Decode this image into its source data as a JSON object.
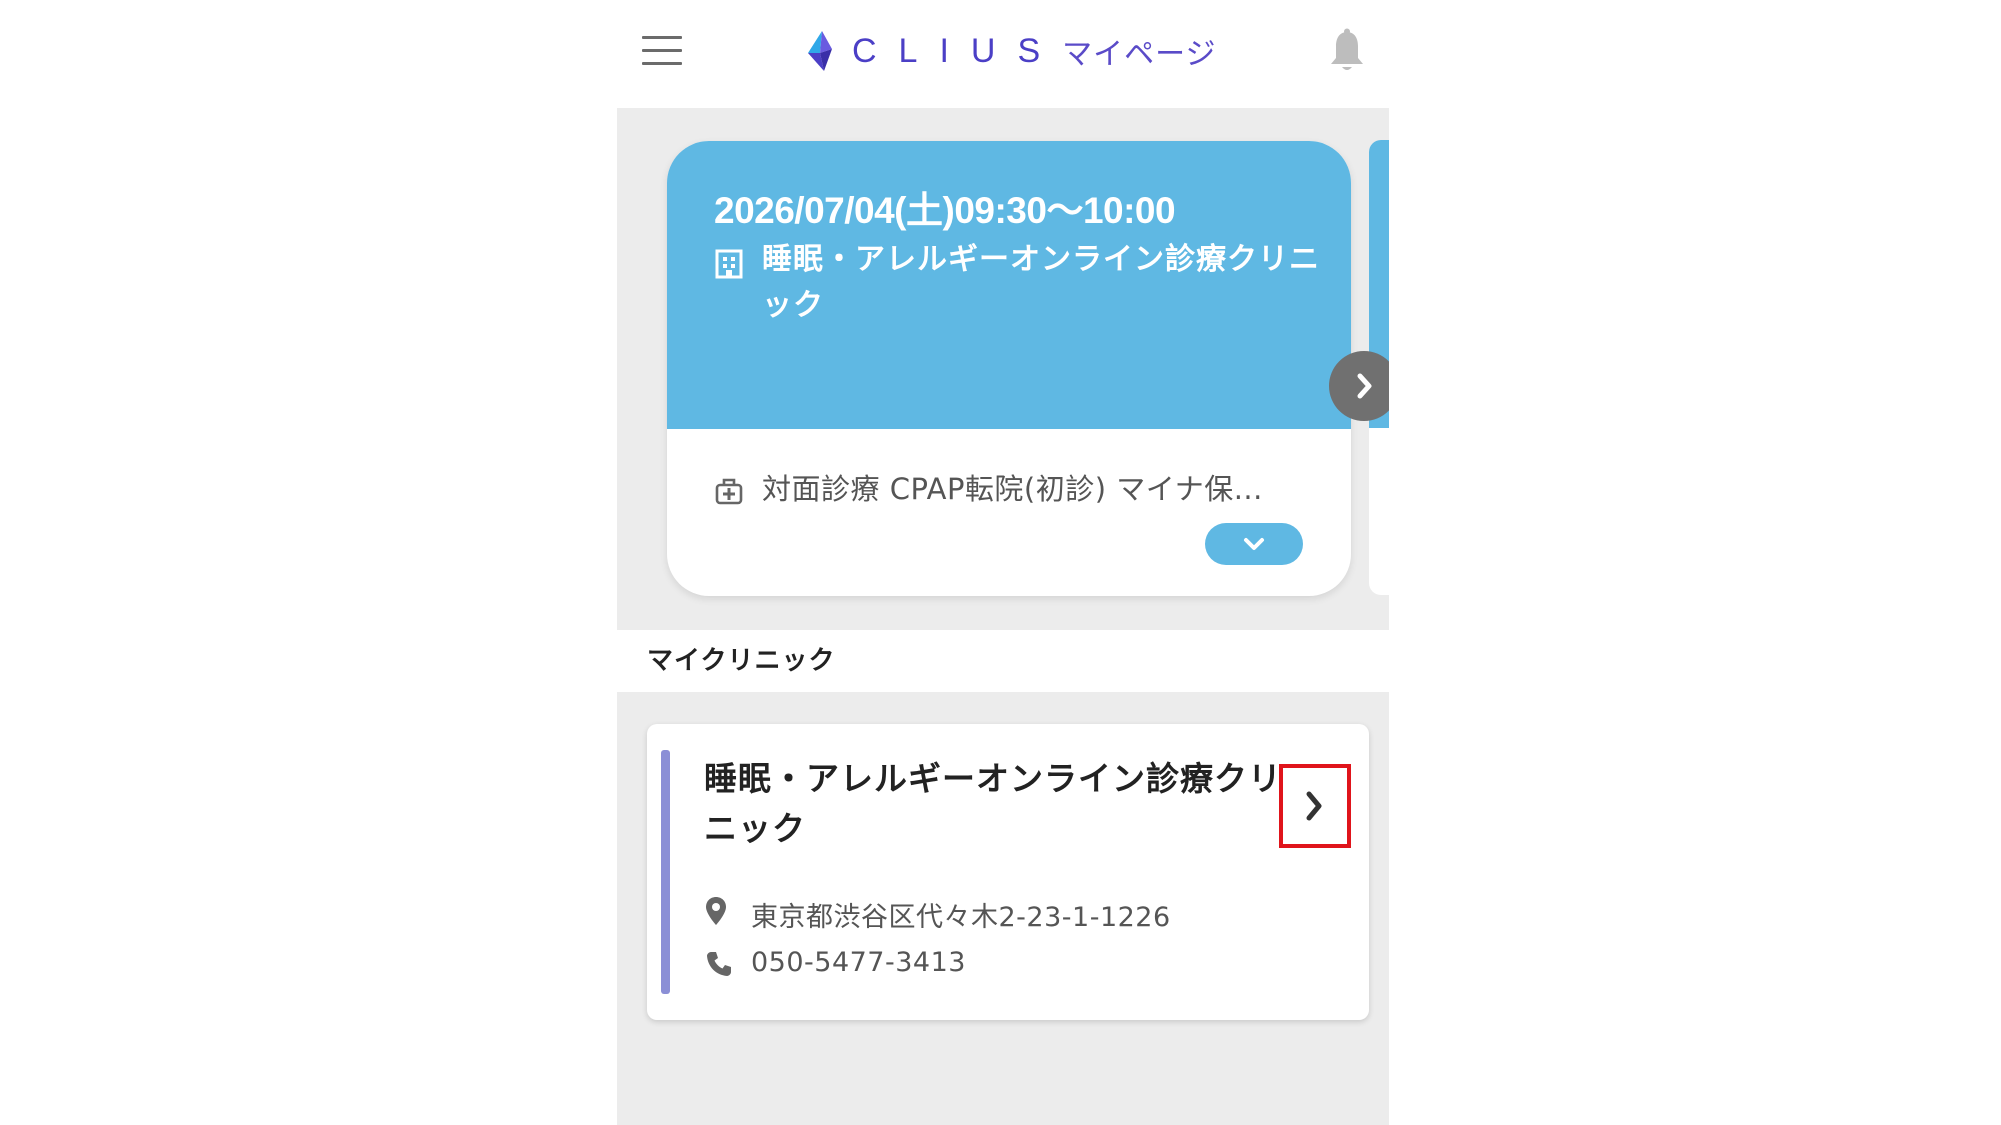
{
  "header": {
    "logo_text": "CLIUS",
    "logo_sub": "マイページ",
    "menu_icon": "hamburger-menu-icon",
    "bell_icon": "bell-icon"
  },
  "appointment": {
    "datetime": "2026/07/04(土)09:30〜10:00",
    "clinic": "睡眠・アレルギーオンライン診療クリニック",
    "menu": "対面診療 CPAP転院(初診) マイナ保...",
    "clinic_icon": "building-icon",
    "menu_icon": "medical-bag-icon",
    "expand_icon": "chevron-down-icon",
    "next_icon": "chevron-right-icon"
  },
  "my_clinic": {
    "section_title": "マイクリニック",
    "name": "睡眠・アレルギーオンライン診療クリニック",
    "address": "東京都渋谷区代々木2-23-1-1226",
    "phone": "050-5477-3413",
    "detail_icon": "chevron-right-icon"
  },
  "colors": {
    "accent_blue": "#5fb8e3",
    "logo_purple": "#4b3fc6",
    "clinic_bar": "#8b8fd6",
    "highlight_red": "#e0141b"
  }
}
